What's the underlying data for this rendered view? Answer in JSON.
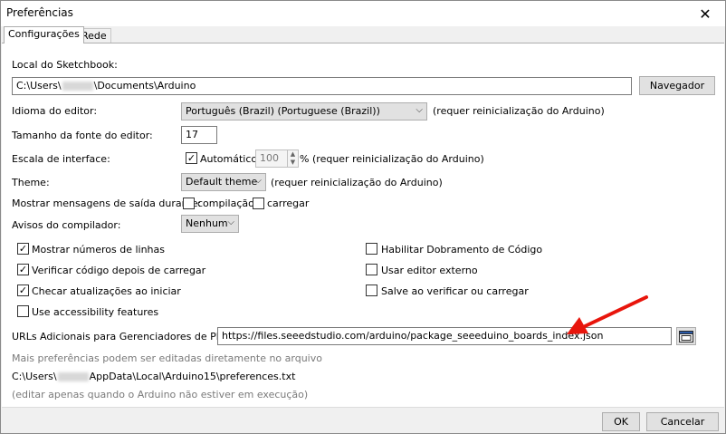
{
  "window": {
    "title": "Preferências",
    "close_glyph": "✕"
  },
  "tabs": [
    {
      "label": "Configurações",
      "active": true
    },
    {
      "label": "Rede",
      "active": false
    }
  ],
  "sketchbook": {
    "label": "Local do Sketchbook:",
    "path_prefix": "C:\\Users\\",
    "path_suffix": "\\Documents\\Arduino",
    "browse_label": "Navegador"
  },
  "language": {
    "label": "Idioma do editor:",
    "value": "Português (Brazil) (Portuguese (Brazil))",
    "note": "(requer reinicialização do Arduino)"
  },
  "font_size": {
    "label": "Tamanho da fonte do editor:",
    "value": "17"
  },
  "scale": {
    "label": "Escala de interface:",
    "auto_label": "Automático",
    "auto_checked": true,
    "value": "100",
    "unit": "%",
    "note": "(requer reinicialização do Arduino)"
  },
  "theme": {
    "label": "Theme:",
    "value": "Default theme",
    "note": "(requer reinicialização do Arduino)"
  },
  "verbose": {
    "label": "Mostrar mensagens de saída durante:",
    "compile_label": "compilação",
    "compile_checked": false,
    "upload_label": "carregar",
    "upload_checked": false
  },
  "warnings": {
    "label": "Avisos do compilador:",
    "value": "Nenhum"
  },
  "options_left": [
    {
      "label": "Mostrar números de linhas",
      "checked": true
    },
    {
      "label": "Verificar código depois de carregar",
      "checked": true
    },
    {
      "label": "Checar atualizações ao iniciar",
      "checked": true
    },
    {
      "label": "Use accessibility features",
      "checked": false
    }
  ],
  "options_right": [
    {
      "label": "Habilitar Dobramento de Código",
      "checked": false
    },
    {
      "label": "Usar editor externo",
      "checked": false
    },
    {
      "label": "Salve ao verificar ou carregar",
      "checked": false
    }
  ],
  "board_urls": {
    "label": "URLs Adicionais para Gerenciadores de Placas:",
    "value": "https://files.seeedstudio.com/arduino/package_seeeduino_boards_index.json",
    "button_icon": "window-edit-icon"
  },
  "more_prefs": {
    "note": "Mais preferências podem ser editadas diretamente no arquivo",
    "path_prefix": "C:\\Users\\",
    "path_suffix": "AppData\\Local\\Arduino15\\preferences.txt",
    "edit_note": "(editar apenas quando o Arduino não estiver em execução)"
  },
  "footer": {
    "ok_label": "OK",
    "cancel_label": "Cancelar"
  },
  "colors": {
    "arrow": "#e8150c",
    "panel": "#ffffff",
    "chrome": "#f0f0f0"
  }
}
